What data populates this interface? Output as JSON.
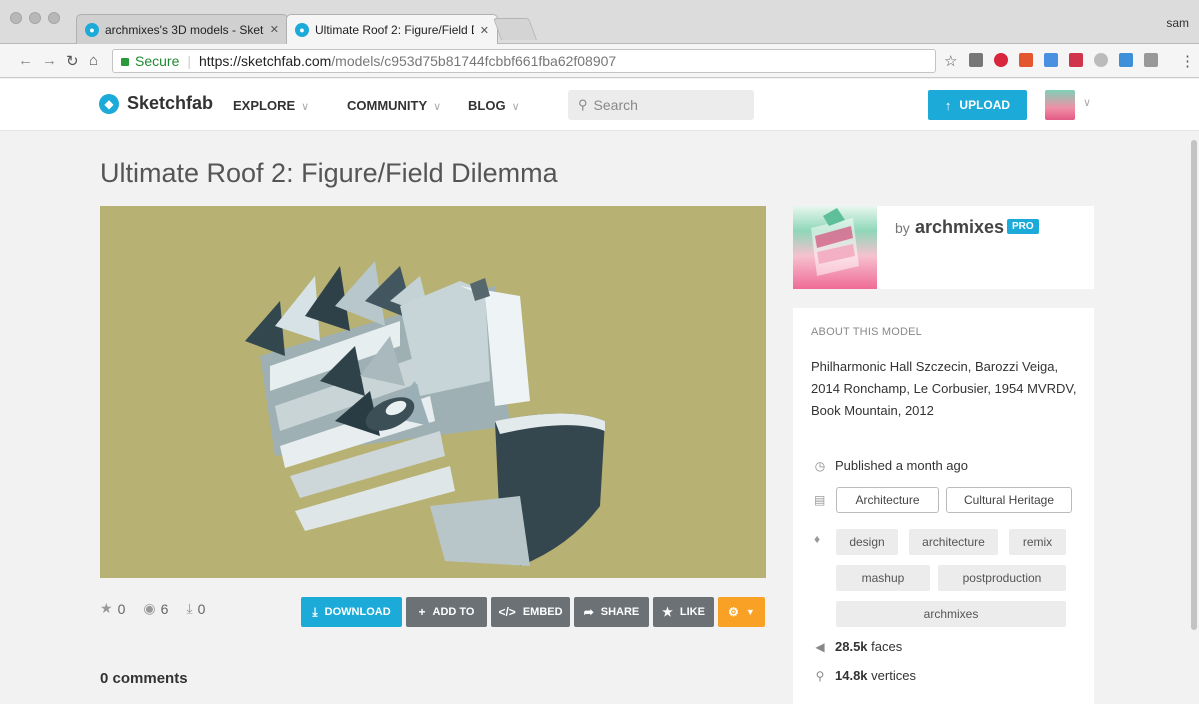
{
  "browser": {
    "tabs": [
      {
        "label": "archmixes's 3D models - Sketc"
      },
      {
        "label": "Ultimate Roof 2: Figure/Field D"
      }
    ],
    "profile": "sam",
    "address": {
      "secure_label": "Secure",
      "url_host": "https://sketchfab.com",
      "url_path": "/models/c953d75b81744fcbbf661fba62f08907"
    }
  },
  "header": {
    "logo": "Sketchfab",
    "nav": [
      {
        "label": "EXPLORE"
      },
      {
        "label": "COMMUNITY"
      },
      {
        "label": "BLOG"
      }
    ],
    "search_placeholder": "Search",
    "upload_label": "UPLOAD"
  },
  "model": {
    "title": "Ultimate Roof 2: Figure/Field Dilemma",
    "stats": {
      "likes": "0",
      "views": "6",
      "downloads": "0"
    },
    "actions": {
      "download": "DOWNLOAD",
      "add_to": "ADD TO",
      "embed": "EMBED",
      "share": "SHARE",
      "like": "LIKE"
    },
    "comments": "0 comments"
  },
  "author": {
    "by": "by",
    "name": "archmixes",
    "badge": "PRO"
  },
  "about": {
    "heading": "ABOUT THIS MODEL",
    "description": "Philharmonic Hall Szczecin, Barozzi Veiga, 2014 Ronchamp, Le Corbusier, 1954 MVRDV, Book Mountain, 2012",
    "published": "Published a month ago",
    "categories": [
      "Architecture",
      "Cultural Heritage"
    ],
    "tags": [
      "design",
      "architecture",
      "remix",
      "mashup",
      "postproduction",
      "archmixes"
    ],
    "faces_value": "28.5k",
    "faces_label": "faces",
    "vertices_value": "14.8k",
    "vertices_label": "vertices"
  }
}
